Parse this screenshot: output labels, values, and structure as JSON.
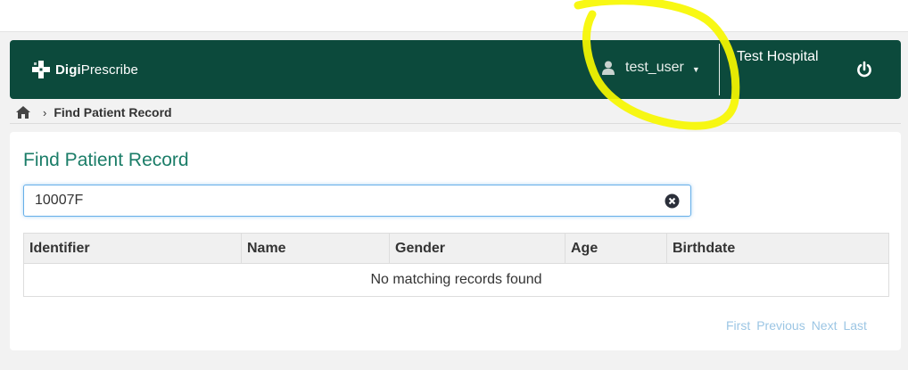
{
  "app": {
    "brand_bold": "Digi",
    "brand_rest": "Prescribe"
  },
  "header": {
    "username": "test_user",
    "hospital": "Test Hospital",
    "logout_icon": "power-icon"
  },
  "breadcrumb": {
    "home_icon": "home-icon",
    "current": "Find Patient Record"
  },
  "main": {
    "title": "Find Patient Record",
    "search": {
      "value": "10007F",
      "clear_icon": "times-circle-icon"
    },
    "table": {
      "columns": [
        "Identifier",
        "Name",
        "Gender",
        "Age",
        "Birthdate"
      ],
      "empty_message": "No matching records found"
    },
    "pagination": {
      "first": "First",
      "previous": "Previous",
      "next": "Next",
      "last": "Last"
    }
  },
  "colors": {
    "navbar": "#0c4a3c",
    "title": "#1b7d68",
    "pager_link": "#9cc6e4",
    "annotation": "#ffff00"
  }
}
